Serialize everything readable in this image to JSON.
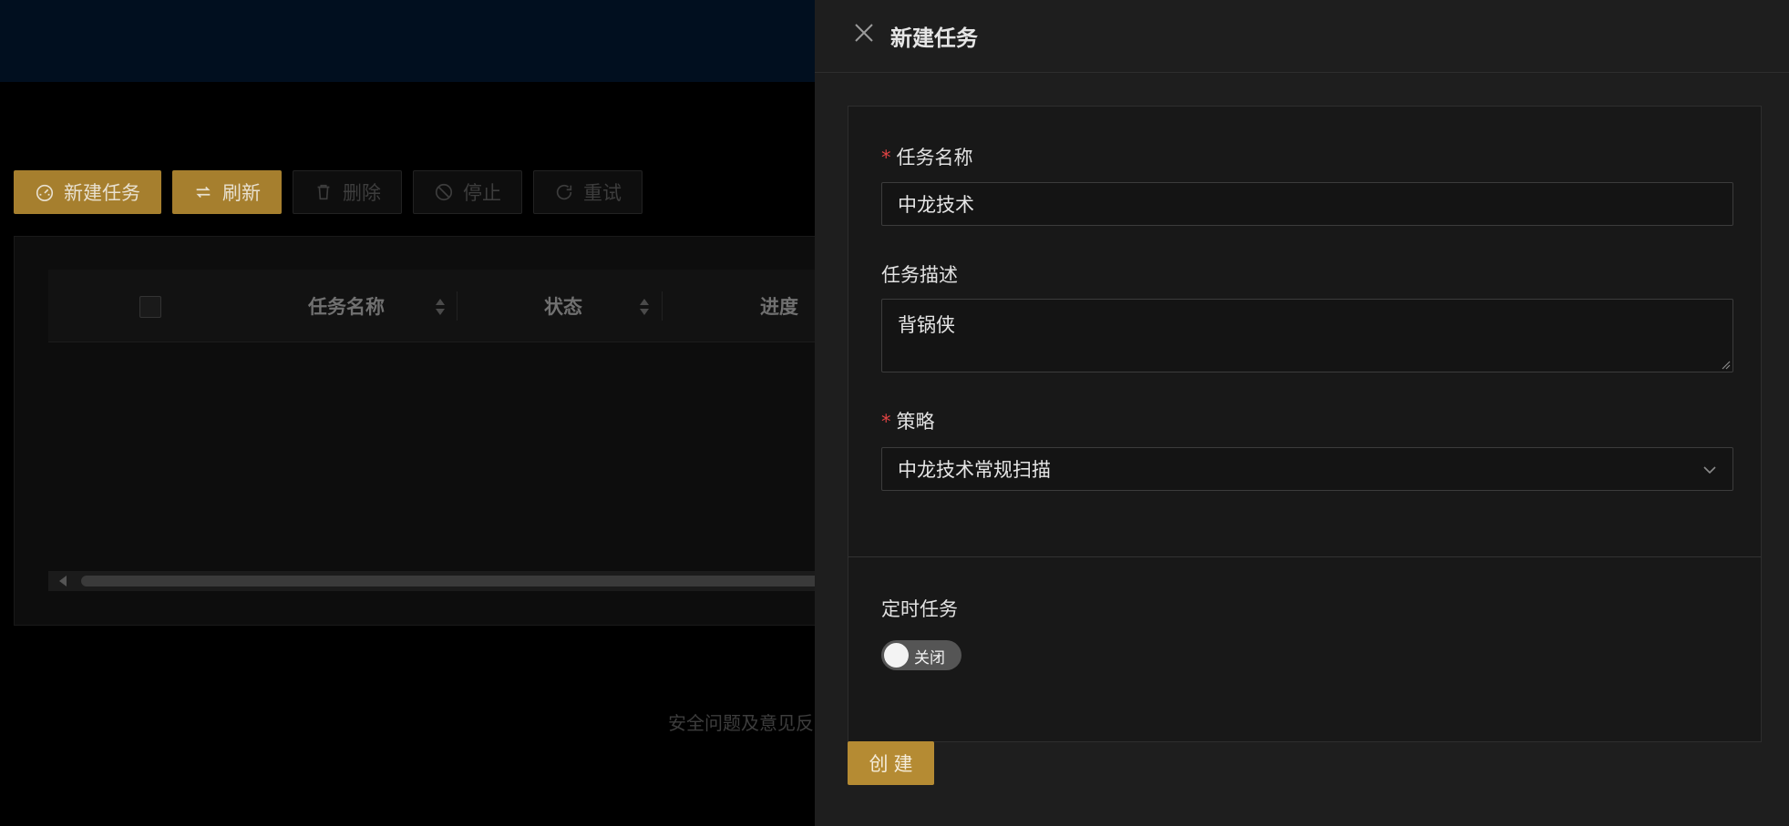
{
  "toolbar": {
    "new_task": "新建任务",
    "refresh": "刷新",
    "delete": "删除",
    "stop": "停止",
    "retry": "重试"
  },
  "table": {
    "columns": [
      "任务名称",
      "状态",
      "进度"
    ]
  },
  "footer": {
    "text": "安全问题及意见反"
  },
  "drawer": {
    "title": "新建任务",
    "fields": {
      "task_name_label": "任务名称",
      "task_name_value": "中龙技术",
      "task_desc_label": "任务描述",
      "task_desc_value": "背锅侠",
      "strategy_label": "策略",
      "strategy_value": "中龙技术常规扫描",
      "schedule_label": "定时任务",
      "schedule_switch": "关闭"
    },
    "submit": "创建"
  },
  "colors": {
    "accent": "#b58b33",
    "required": "#e04343",
    "drawer_bg": "#1e1e1e"
  }
}
